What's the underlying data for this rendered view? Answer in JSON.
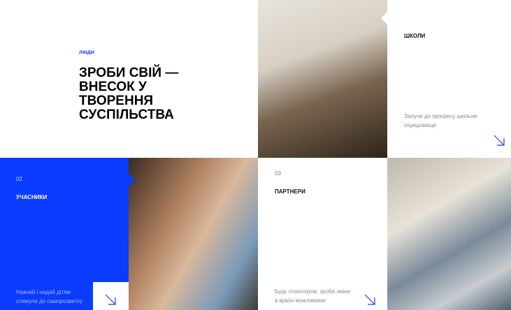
{
  "hero": {
    "label": "люди",
    "heading": "ЗРОБИ СВІЙ — ВНЕСОК У ТВОРЕННЯ СУСПІЛЬСТВА"
  },
  "cards": [
    {
      "number": "",
      "title": "ШКОЛИ",
      "description": "Залучи до прогресу шкільне середовище",
      "icon": "arrow-down-right-icon"
    },
    {
      "number": "02",
      "title": "УЧАСНИКИ",
      "description": "Навчай і надай дітям стимули до саморозвитку",
      "icon": "arrow-down-right-icon"
    },
    {
      "number": "03",
      "title": "ПАРТНЕРИ",
      "description": "Будь спонсором, зроби зміни в країні можливими",
      "icon": "arrow-down-right-icon"
    }
  ],
  "colors": {
    "accent": "#0a3cff"
  }
}
